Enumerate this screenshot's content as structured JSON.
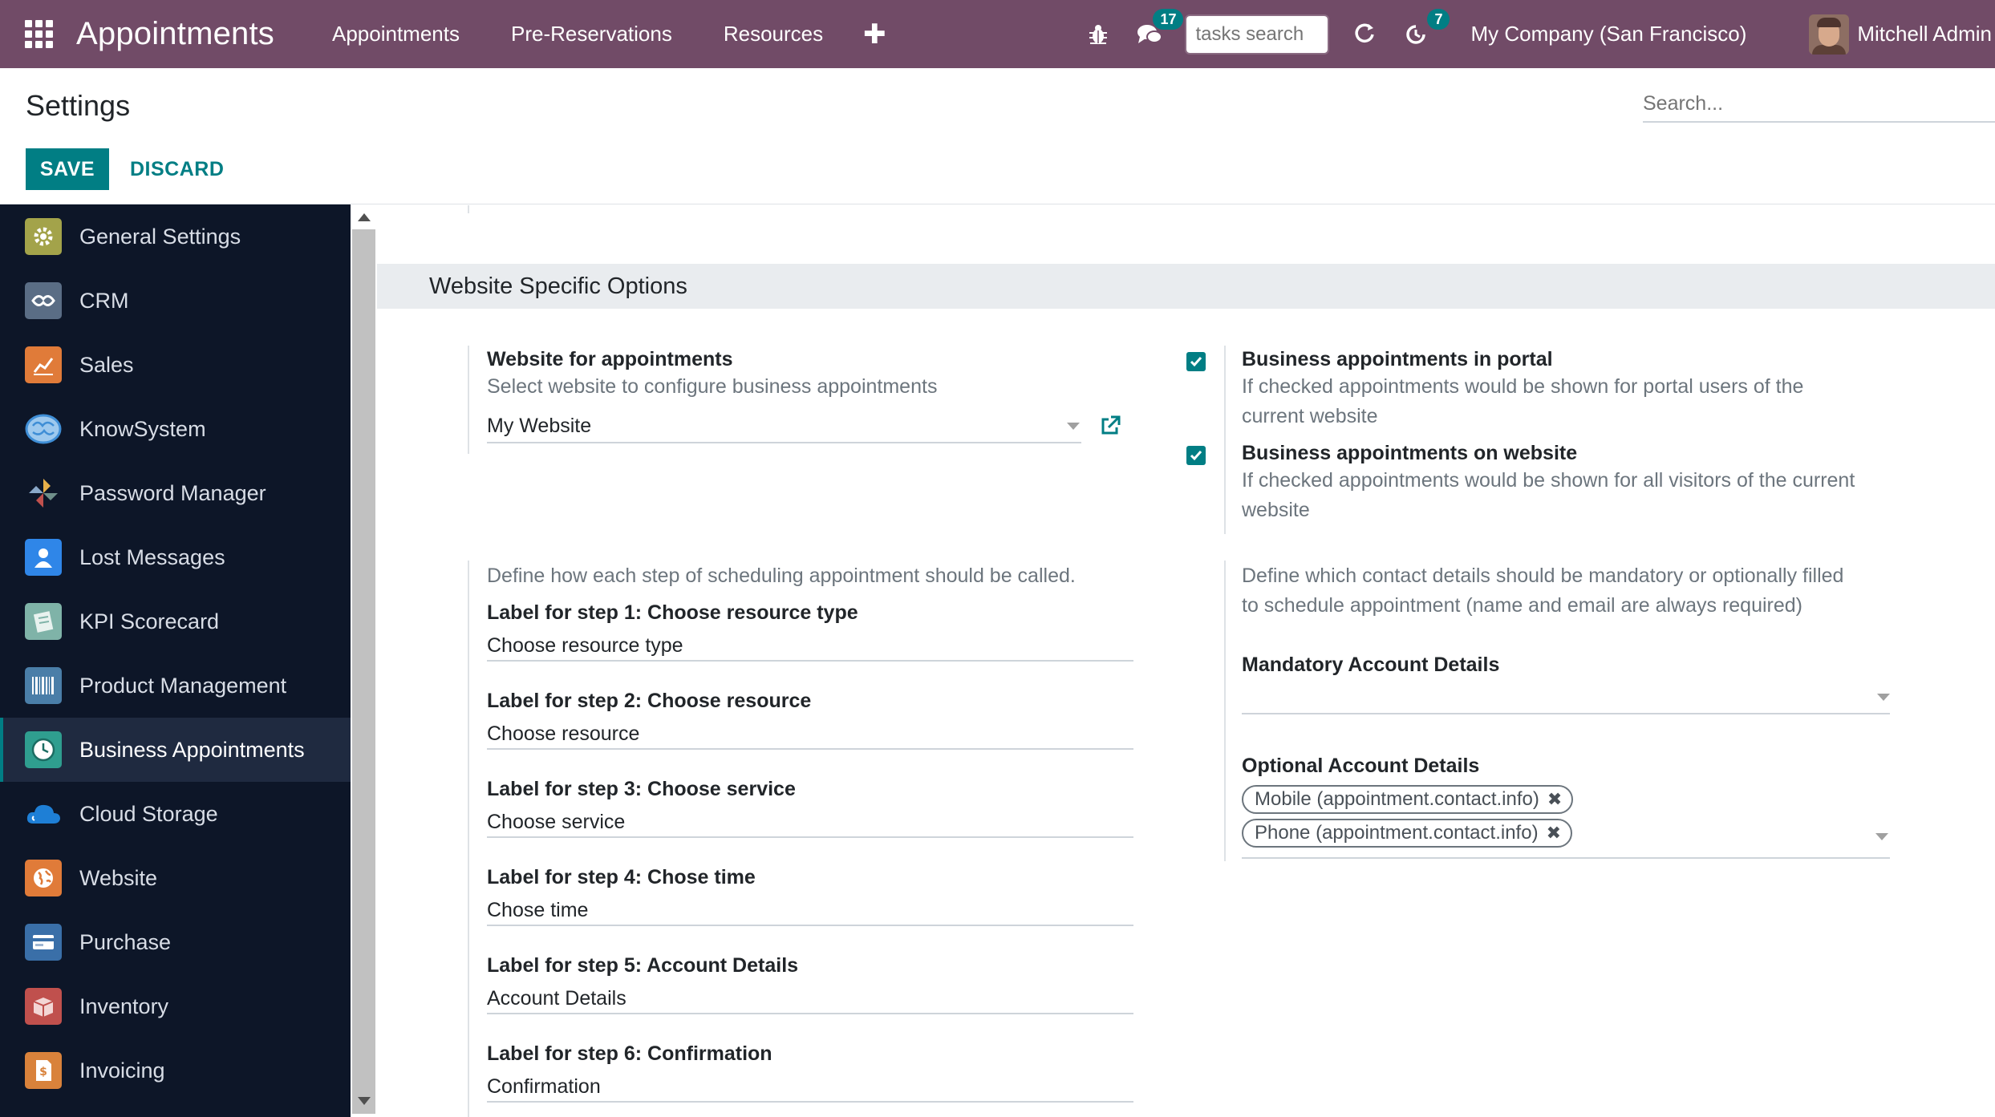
{
  "navbar": {
    "app_title": "Appointments",
    "menu": [
      "Appointments",
      "Pre-Reservations",
      "Resources"
    ],
    "plus_label": "✚",
    "messages_count": "17",
    "tasks_search_placeholder": "tasks search",
    "activities_count": "7",
    "company": "My Company (San Francisco)",
    "user": "Mitchell Admin"
  },
  "control_panel": {
    "breadcrumb": "Settings",
    "search_placeholder": "Search...",
    "save_label": "SAVE",
    "discard_label": "DISCARD"
  },
  "sidebar": {
    "items": [
      {
        "label": "General Settings",
        "icon": "gear-icon",
        "color": "#a3a34a"
      },
      {
        "label": "CRM",
        "icon": "handshake-icon",
        "color": "#5a6d85"
      },
      {
        "label": "Sales",
        "icon": "chart-icon",
        "color": "#e07b39"
      },
      {
        "label": "KnowSystem",
        "icon": "brain-icon",
        "color": "#3f8ed6"
      },
      {
        "label": "Password Manager",
        "icon": "pinwheel-icon",
        "color": "#6f8f8a"
      },
      {
        "label": "Lost Messages",
        "icon": "user-icon",
        "color": "#2f86e8"
      },
      {
        "label": "KPI Scorecard",
        "icon": "scorecard-icon",
        "color": "#7fb3a8"
      },
      {
        "label": "Product Management",
        "icon": "barcode-icon",
        "color": "#4a7ea8"
      },
      {
        "label": "Business Appointments",
        "icon": "clock-icon",
        "color": "#2f9e8f"
      },
      {
        "label": "Cloud Storage",
        "icon": "cloud-icon",
        "color": "#1e7fd6"
      },
      {
        "label": "Website",
        "icon": "globe-icon",
        "color": "#e07b39"
      },
      {
        "label": "Purchase",
        "icon": "card-icon",
        "color": "#3a6fa8"
      },
      {
        "label": "Inventory",
        "icon": "box-icon",
        "color": "#c0504d"
      },
      {
        "label": "Invoicing",
        "icon": "invoice-icon",
        "color": "#d9823b"
      }
    ],
    "active_index": 8
  },
  "section": {
    "title": "Website Specific Options"
  },
  "website_setting": {
    "label": "Website for appointments",
    "help": "Select website to configure business appointments",
    "value": "My Website"
  },
  "portal_setting": {
    "label": "Business appointments in portal",
    "help_line1": "If checked appointments would be shown for portal users of the",
    "help_line2": "current website",
    "checked": true
  },
  "website_visibility_setting": {
    "label": "Business appointments on website",
    "help_line1": "If checked appointments would be shown for all visitors of the current",
    "help_line2": "website",
    "checked": true
  },
  "steps_setting": {
    "help": "Define how each step of scheduling appointment should be called.",
    "steps": [
      {
        "label": "Label for step 1: Choose resource type",
        "value": "Choose resource type"
      },
      {
        "label": "Label for step 2: Choose resource",
        "value": "Choose resource"
      },
      {
        "label": "Label for step 3: Choose service",
        "value": "Choose service"
      },
      {
        "label": "Label for step 4: Chose time",
        "value": "Chose time"
      },
      {
        "label": "Label for step 5: Account Details",
        "value": "Account Details"
      },
      {
        "label": "Label for step 6: Confirmation",
        "value": "Confirmation"
      }
    ]
  },
  "contact_setting": {
    "help_line1": "Define which contact details should be mandatory or optionally filled",
    "help_line2": "to schedule appointment (name and email are always required)",
    "mandatory_label": "Mandatory Account Details",
    "mandatory_tags": [],
    "optional_label": "Optional Account Details",
    "optional_tags": [
      "Mobile (appointment.contact.info)",
      "Phone (appointment.contact.info)"
    ]
  }
}
